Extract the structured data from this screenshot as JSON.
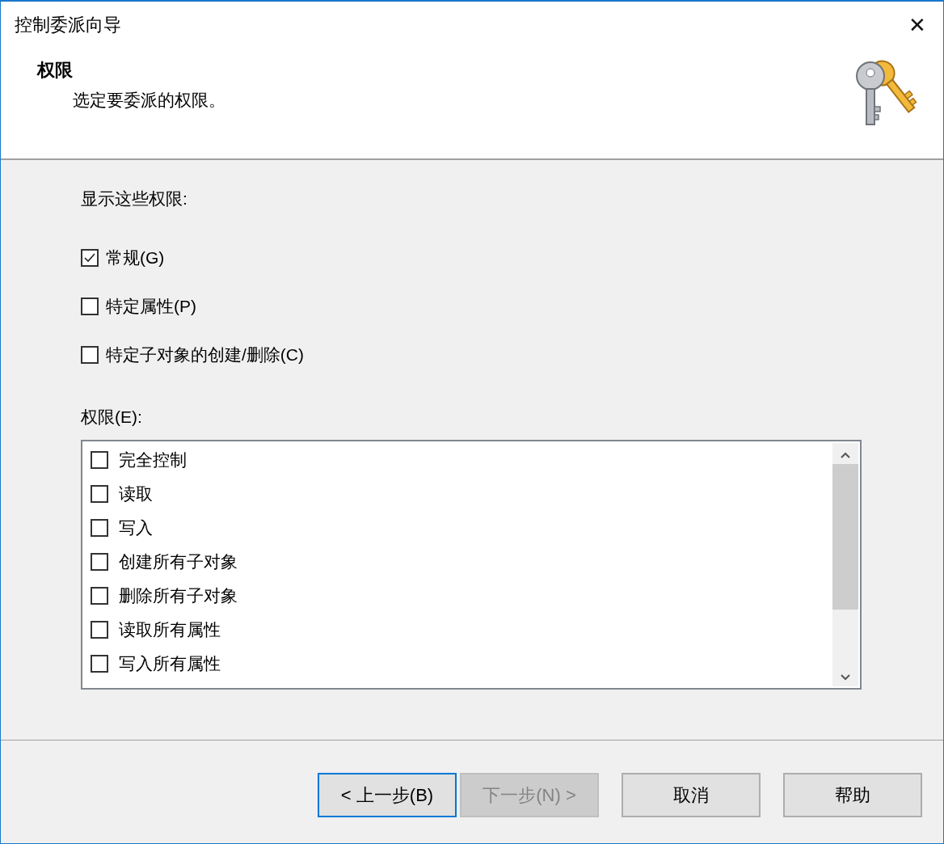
{
  "window": {
    "title": "控制委派向导",
    "close": "✕"
  },
  "header": {
    "heading": "权限",
    "subtitle": "选定要委派的权限。"
  },
  "show_label": "显示这些权限:",
  "filters": [
    {
      "label": "常规(G)",
      "checked": true
    },
    {
      "label": "特定属性(P)",
      "checked": false
    },
    {
      "label": "特定子对象的创建/删除(C)",
      "checked": false
    }
  ],
  "permissions_label": "权限(E):",
  "permissions": [
    {
      "label": "完全控制",
      "checked": false
    },
    {
      "label": "读取",
      "checked": false
    },
    {
      "label": "写入",
      "checked": false
    },
    {
      "label": "创建所有子对象",
      "checked": false
    },
    {
      "label": "删除所有子对象",
      "checked": false
    },
    {
      "label": "读取所有属性",
      "checked": false
    },
    {
      "label": "写入所有属性",
      "checked": false
    }
  ],
  "buttons": [
    {
      "label": "< 上一步(B)",
      "focused": true,
      "disabled": false
    },
    {
      "label": "下一步(N) >",
      "focused": false,
      "disabled": true
    },
    {
      "label": "取消",
      "focused": false,
      "disabled": false
    },
    {
      "label": "帮助",
      "focused": false,
      "disabled": false
    }
  ]
}
